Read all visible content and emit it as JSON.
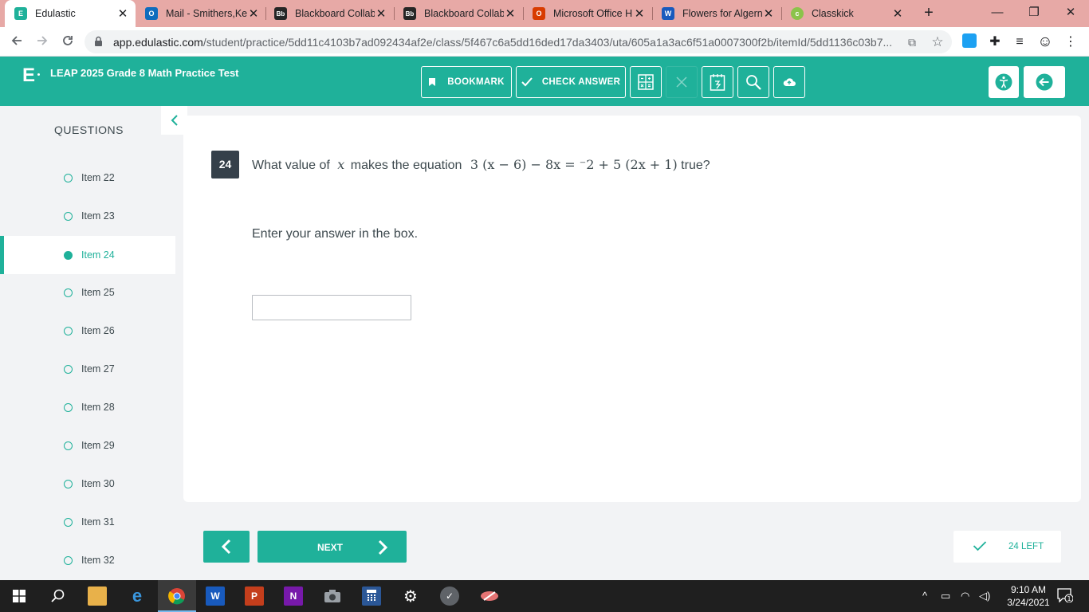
{
  "browser": {
    "tabs": [
      {
        "title": "Edulastic",
        "icon": "edulastic-favicon",
        "active": true
      },
      {
        "title": "Mail - Smithers,Ke",
        "icon": "outlook-favicon"
      },
      {
        "title": "Blackboard Collab",
        "icon": "blackboard-favicon"
      },
      {
        "title": "Blackboard Collab",
        "icon": "blackboard-favicon"
      },
      {
        "title": "Microsoft Office H",
        "icon": "office-favicon"
      },
      {
        "title": "Flowers for Algern",
        "icon": "word-favicon"
      },
      {
        "title": "Classkick",
        "icon": "classkick-favicon"
      }
    ],
    "url_host": "app.edulastic.com",
    "url_path": "/student/practice/5dd11c4103b7ad092434af2e/class/5f467c6a5dd16ded17da3403/uta/605a1a3ac6f51a0007300f2b/itemId/5dd1136c03b7..."
  },
  "header": {
    "title": "LEAP 2025 Grade 8 Math Practice Test",
    "bookmark_label": "BOOKMARK",
    "check_answer_label": "CHECK ANSWER"
  },
  "sidebar": {
    "heading": "QUESTIONS",
    "items": [
      {
        "label": "Item 22"
      },
      {
        "label": "Item 23"
      },
      {
        "label": "Item 24",
        "active": true
      },
      {
        "label": "Item 25"
      },
      {
        "label": "Item 26"
      },
      {
        "label": "Item 27"
      },
      {
        "label": "Item 28"
      },
      {
        "label": "Item 29"
      },
      {
        "label": "Item 30"
      },
      {
        "label": "Item 31"
      },
      {
        "label": "Item 32"
      }
    ]
  },
  "question": {
    "number": "24",
    "text_before": "What value of",
    "variable": "x",
    "text_middle": "makes the equation",
    "equation": {
      "lhs_coef": "3",
      "lhs_inner": "(x − 6)",
      "lhs_rest": " − 8x = ",
      "neg_sign": "⁻",
      "rhs_const": "2 + 5",
      "rhs_inner": "(2x + 1)"
    },
    "text_after": "true?",
    "prompt": "Enter your answer in the box.",
    "answer_value": "",
    "answer_placeholder": ""
  },
  "footer": {
    "next_label": "NEXT",
    "left_label": "24 LEFT"
  },
  "taskbar": {
    "time": "9:10 AM",
    "date": "3/24/2021",
    "notification_count": "1"
  },
  "colors": {
    "accent": "#1fb19a",
    "tab_strip": "#e7a9a6",
    "question_badge": "#35404a"
  }
}
